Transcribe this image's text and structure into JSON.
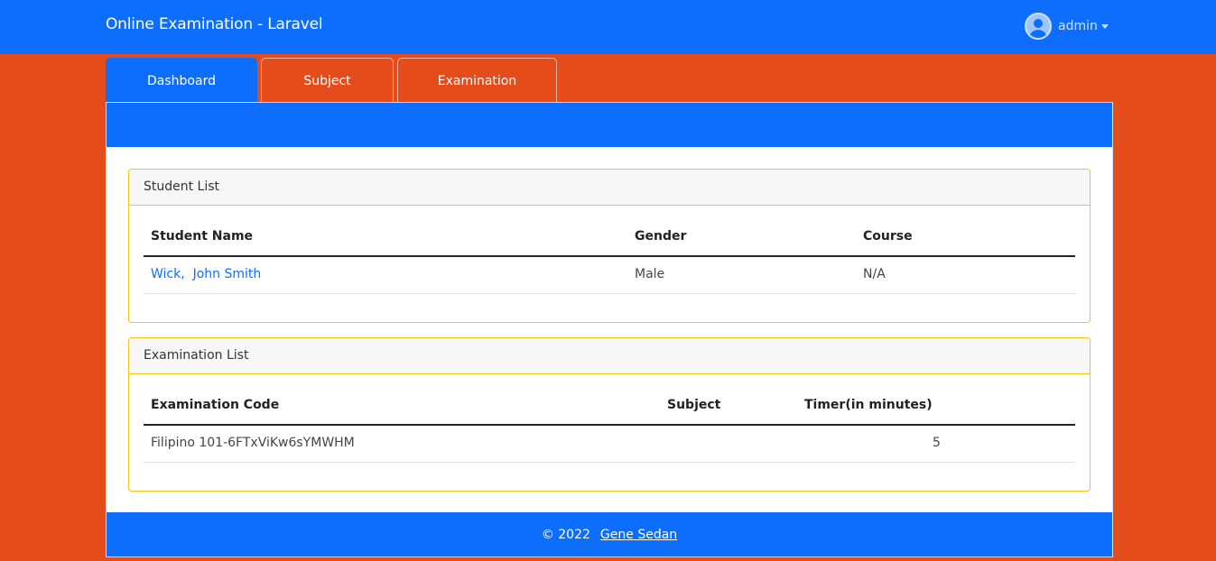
{
  "navbar": {
    "brand": "Online Examination - Laravel",
    "user": "admin"
  },
  "tabs": [
    {
      "label": "Dashboard",
      "active": true
    },
    {
      "label": "Subject",
      "active": false
    },
    {
      "label": "Examination",
      "active": false
    }
  ],
  "student_list": {
    "title": "Student List",
    "columns": [
      "Student Name",
      "Gender",
      "Course"
    ],
    "rows": [
      {
        "name": "Wick,  John Smith",
        "gender": "Male",
        "course": "N/A"
      }
    ]
  },
  "exam_list": {
    "title": "Examination List",
    "columns": [
      "Examination Code",
      "Subject",
      "Timer(in minutes)"
    ],
    "rows": [
      {
        "code": "Filipino 101-6FTxViKw6sYMWHM",
        "subject": "",
        "timer": "5"
      }
    ]
  },
  "footer": {
    "copyright": "© 2022",
    "author": "Gene Sedan"
  },
  "colors": {
    "primary": "#0d6efd",
    "background": "#e44c1b",
    "card_border": "#f0c419"
  }
}
